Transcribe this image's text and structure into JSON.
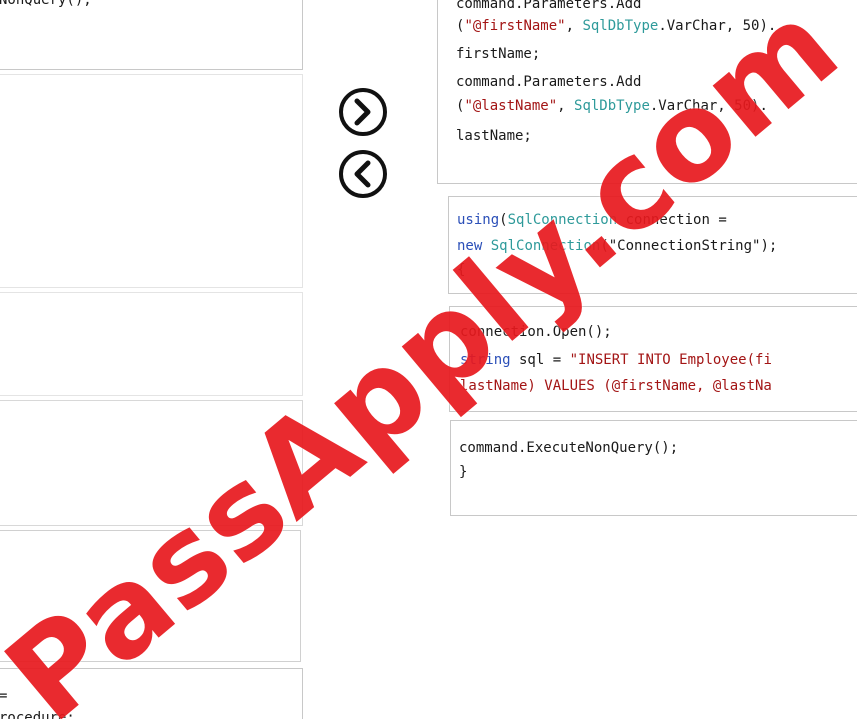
{
  "left_panel": {
    "top_fragment": "NonQuery();",
    "bottom_fragment_1": "=",
    "bottom_fragment_2": "rocedure;"
  },
  "nav": {
    "move_right_icon": "chevron-right-icon",
    "move_left_icon": "chevron-left-icon"
  },
  "right_panel": {
    "block1": {
      "line1": "command.Parameters.Add",
      "line2_a": "(",
      "line2_b": "\"@firstName\"",
      "line2_c": ", ",
      "line2_d": "SqlDbType",
      "line2_e": ".VarChar, 50).",
      "line3": "firstName;",
      "line4": "command.Parameters.Add",
      "line5_a": "(",
      "line5_b": "\"@lastName\"",
      "line5_c": ", ",
      "line5_d": "SqlDbType",
      "line5_e": ".VarChar, 50).",
      "line6": "lastName;"
    },
    "block2": {
      "line1_kw": "using",
      "line1_a": "(",
      "line1_ty": "SqlConnection",
      "line1_b": " connection =",
      "line2_kw": "new",
      "line2_a": " ",
      "line2_ty": "SqlConnection",
      "line2_b": "(\"ConnectionString\");",
      "line3": "{"
    },
    "block3": {
      "line1": "connection.Open();",
      "line2_kw": "string",
      "line2_a": " sql = ",
      "line2_st": "\"INSERT INTO Employee(fi",
      "line3_st": "lastName) VALUES (@firstName, @lastNa"
    },
    "block4": {
      "line1": "command.ExecuteNonQuery();",
      "line2": "}"
    }
  },
  "watermark": {
    "text": "PassApply.com"
  },
  "colors": {
    "keyword": "#2b4fb8",
    "type": "#2e9a9a",
    "string": "#a31515",
    "watermark": "#e8191e"
  }
}
